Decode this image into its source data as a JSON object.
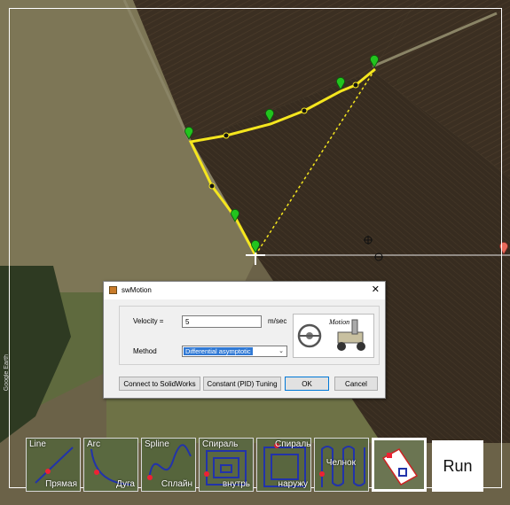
{
  "map": {
    "side_label": "Google Earth",
    "route_color": "#f5e61e",
    "marker_color": "#22c41e"
  },
  "dialog": {
    "title": "swMotion",
    "close_glyph": "✕",
    "velocity_label": "Velocity =",
    "velocity_value": "5",
    "velocity_unit": "m/sec",
    "method_label": "Method",
    "method_value": "Differential asymptotic",
    "image_caption": "Motion",
    "buttons": {
      "connect": "Connect to SolidWorks",
      "pid": "Constant (PID) Tuning",
      "ok": "OK",
      "cancel": "Cancel"
    }
  },
  "toolbar": {
    "tools": [
      {
        "top": "Line",
        "bottom": "Прямая"
      },
      {
        "top": "Arc",
        "bottom": "Дуга"
      },
      {
        "top": "Spline",
        "bottom": "Сплайн"
      },
      {
        "top": "Спираль",
        "bottom": "внутрь"
      },
      {
        "top": "Спираль",
        "bottom": "наружу"
      },
      {
        "top": "",
        "bottom": "Челнок"
      }
    ],
    "run_label": "Run"
  }
}
